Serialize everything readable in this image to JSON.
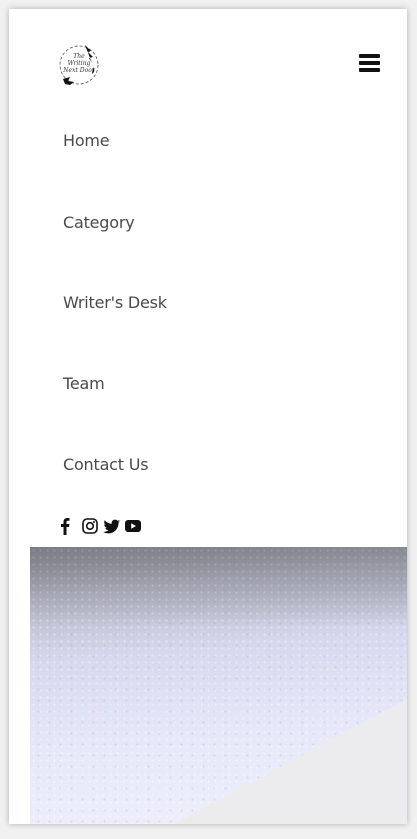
{
  "logo": {
    "lines": [
      "The",
      "Writing",
      "Next Door"
    ]
  },
  "header": {
    "menu_icon": "hamburger-icon"
  },
  "nav": {
    "items": [
      {
        "label": "Home"
      },
      {
        "label": "Category"
      },
      {
        "label": "Writer's Desk"
      },
      {
        "label": "Team"
      },
      {
        "label": "Contact Us"
      }
    ]
  },
  "social": {
    "icons": [
      "facebook-icon",
      "instagram-icon",
      "twitter-icon",
      "youtube-icon"
    ]
  },
  "colors": {
    "nav_text": "#4a4a4a",
    "icon": "#111111",
    "hero_tint": "#dcdff3"
  }
}
